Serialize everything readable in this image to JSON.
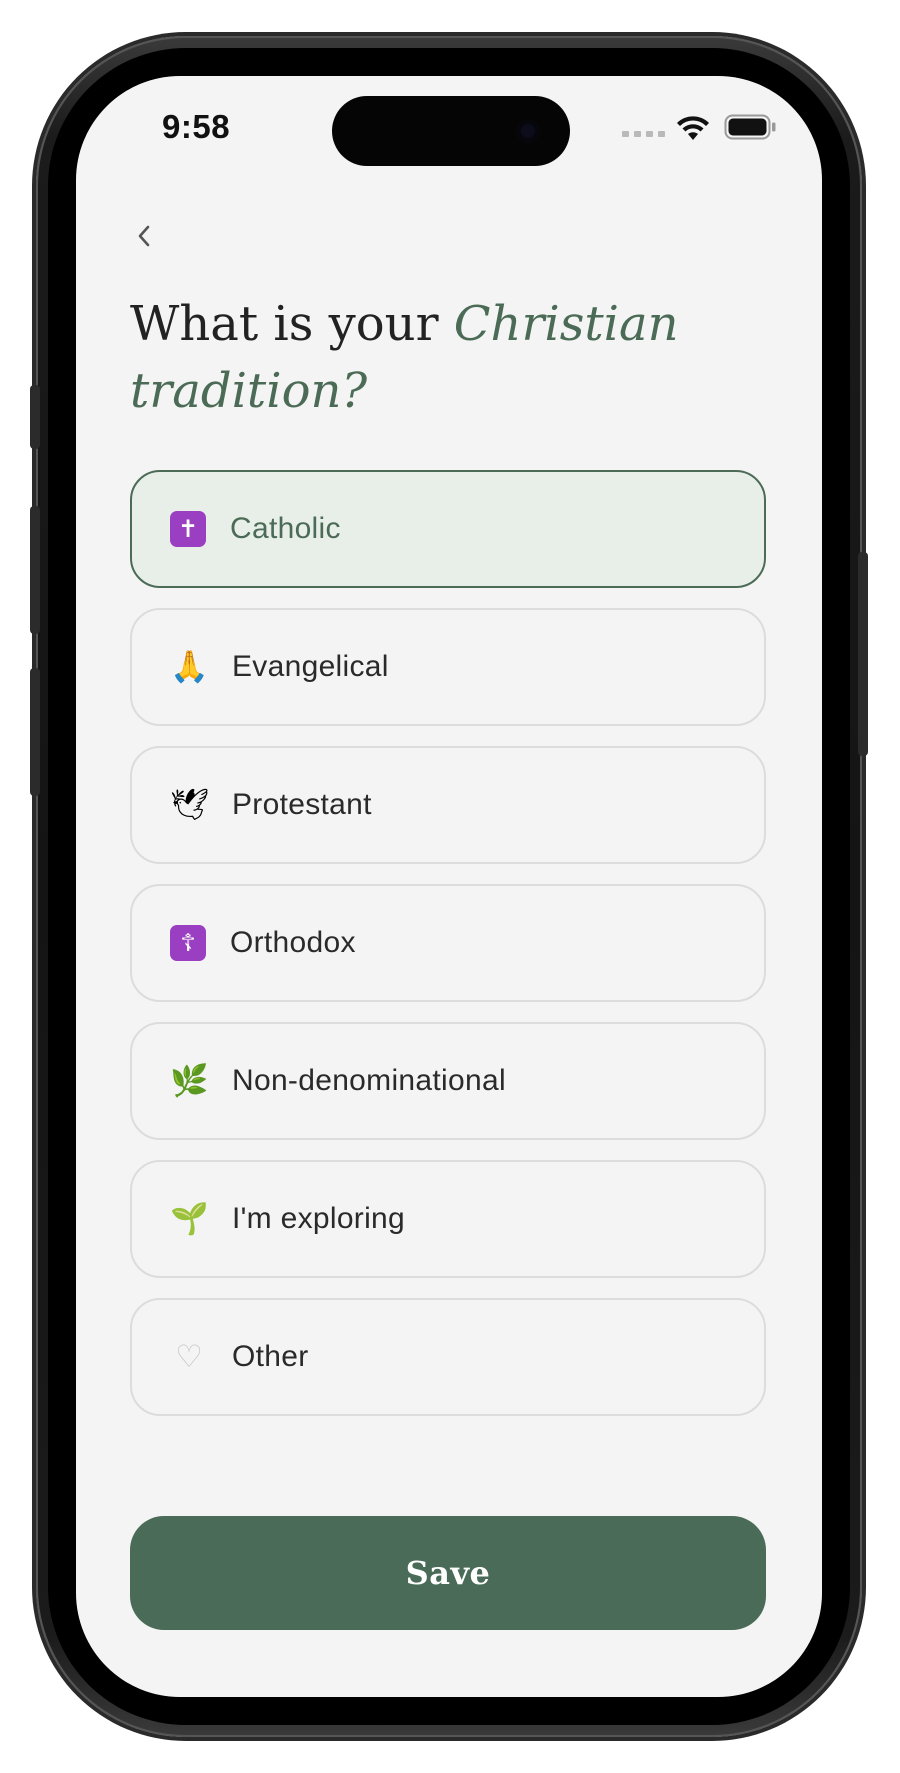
{
  "status_bar": {
    "time": "9:58"
  },
  "header": {
    "title_prefix": "What is your ",
    "title_accent": "Christian tradition?"
  },
  "options": [
    {
      "icon": "latin-cross-icon",
      "glyph": "✝",
      "label": "Catholic",
      "selected": true
    },
    {
      "icon": "praying-hands-icon",
      "glyph": "🙏",
      "label": "Evangelical",
      "selected": false
    },
    {
      "icon": "dove-icon",
      "glyph": "🕊",
      "label": "Protestant",
      "selected": false
    },
    {
      "icon": "orthodox-cross-icon",
      "glyph": "☦",
      "label": "Orthodox",
      "selected": false
    },
    {
      "icon": "herb-icon",
      "glyph": "🌿",
      "label": "Non-denominational",
      "selected": false
    },
    {
      "icon": "seedling-icon",
      "glyph": "🌱",
      "label": "I'm exploring",
      "selected": false
    },
    {
      "icon": "white-heart-icon",
      "glyph": "♡",
      "label": "Other",
      "selected": false
    }
  ],
  "save_button": {
    "label": "Save"
  },
  "colors": {
    "accent": "#4b6b56",
    "selected_background": "#e8efe8",
    "screen_background": "#f4f4f4",
    "button_background": "#4a6b57"
  }
}
